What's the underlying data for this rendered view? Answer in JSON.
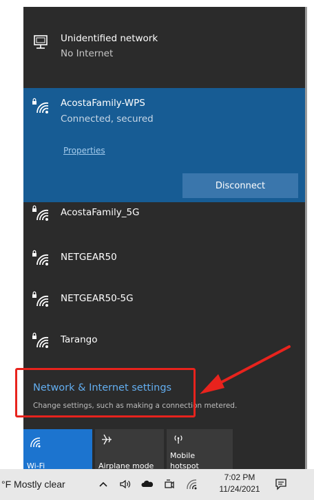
{
  "networks": {
    "unidentified": {
      "name": "Unidentified network",
      "status": "No Internet"
    },
    "connected": {
      "name": "AcostaFamily-WPS",
      "status": "Connected, secured",
      "properties_label": "Properties",
      "disconnect_label": "Disconnect"
    },
    "available": [
      {
        "name": "AcostaFamily_5G"
      },
      {
        "name": "NETGEAR50"
      },
      {
        "name": "NETGEAR50-5G"
      },
      {
        "name": "Tarango"
      }
    ]
  },
  "settings": {
    "title": "Network & Internet settings",
    "description": "Change settings, such as making a connection metered."
  },
  "quick_actions": [
    {
      "label": "Wi-Fi",
      "active": true,
      "icon": "wifi-icon"
    },
    {
      "label": "Airplane mode",
      "active": false,
      "icon": "airplane-icon"
    },
    {
      "label_line1": "Mobile",
      "label_line2": "hotspot",
      "active": false,
      "icon": "hotspot-icon"
    }
  ],
  "taskbar": {
    "weather": "°F  Mostly clear",
    "time": "7:02 PM",
    "date": "11/24/2021"
  },
  "colors": {
    "panel_bg": "#2b2b2b",
    "selected_bg": "#175c94",
    "accent_blue": "#1c74cf",
    "link_blue": "#63aef0",
    "annotation_red": "#e8231d"
  }
}
